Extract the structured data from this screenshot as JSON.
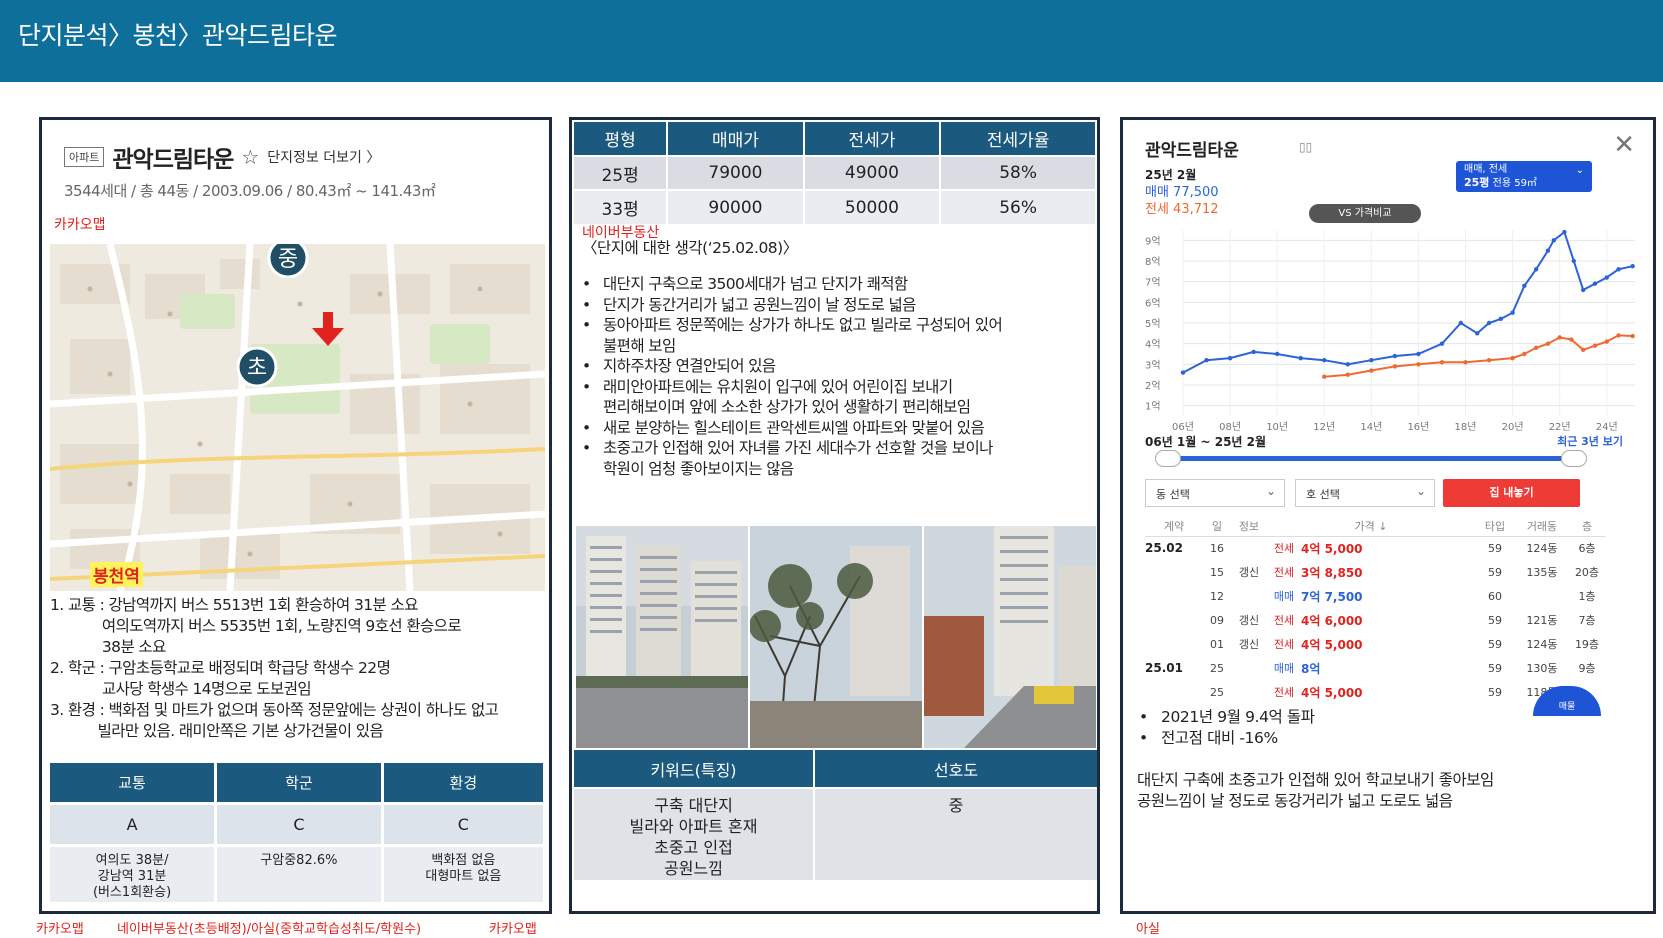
{
  "header": {
    "title": "단지분석〉봉천〉관악드림타운"
  },
  "panel1": {
    "badge": "아파트",
    "name": "관악드림타운",
    "more_link": "단지정보 더보기 〉",
    "meta": "3544세대 / 총 44동 / 2003.09.06 / 80.43㎡ ~ 141.43㎡",
    "source_top": "카카오맵",
    "map": {
      "marker_middle": "중",
      "marker_elem": "초",
      "station": "봉천역"
    },
    "notes": [
      "1.   교통 : 강남역까지 버스 5513번 1회 환승하여 31분 소요",
      "            여의도역까지 버스 5535번 1회, 노량진역 9호선 환승으로",
      "            38분 소요",
      "2. 학군 : 구암초등학교로 배정되며 학급당 학생수 22명",
      "            교사당 학생수 14명으로 도보권임",
      "3. 환경 : 백화점 및 마트가 없으며 동아쪽 정문앞에는 상권이 하나도 없고",
      "           빌라만 있음. 래미안쪽은 기본 상가건물이 있음"
    ],
    "grade_table": {
      "headers": [
        "교통",
        "학군",
        "환경"
      ],
      "grades": [
        "A",
        "C",
        "C"
      ],
      "details": [
        [
          "여의도 38분/",
          "강남역 31분",
          "(버스1회환승)"
        ],
        [
          "구암중82.6%"
        ],
        [
          "백화점 없음",
          "대형마트 없음"
        ]
      ]
    },
    "source_bottom_left": "카카오맵",
    "source_bottom_mid": "네이버부동산(초등배정)/아실(중학교학습성취도/학원수)",
    "source_bottom_right": "카카오맵"
  },
  "panel2": {
    "price_table": {
      "headers": [
        "평형",
        "매매가",
        "전세가",
        "전세가율"
      ],
      "rows": [
        [
          "25평",
          "79000",
          "49000",
          "58%"
        ],
        [
          "33평",
          "90000",
          "50000",
          "56%"
        ]
      ]
    },
    "source": "네이버부동산",
    "thought_title": "〈단지에 대한 생각(‘25.02.08)〉",
    "bullets": [
      "대단지 구축으로 3500세대가 넘고 단지가 쾌적함",
      "단지가 동간거리가 넓고 공원느낌이 날 정도로 넓음",
      "동아아파트 정문쪽에는 상가가 하나도 없고 빌라로 구성되어 있어",
      "불편해 보임",
      "지하주차장 연결안되어 있음",
      "래미안아파트에는 유치원이 입구에 있어 어린이집 보내기",
      "편리해보이며 앞에 소소한 상가가 있어 생활하기 편리해보임",
      "새로 분양하는 힐스테이트 관악센트씨엘 아파트와 맞붙어 있음",
      "초중고가 인접해 있어 자녀를 가진 세대수가 선호할 것을 보이나",
      "학원이 엄청 좋아보이지는 않음"
    ],
    "bullet_flags": [
      true,
      true,
      true,
      false,
      true,
      true,
      false,
      true,
      true,
      false
    ],
    "keyword_table": {
      "headers": [
        "키워드(특징)",
        "선호도"
      ],
      "keywords": [
        "구축 대단지",
        "빌라와 아파트 혼재",
        "초중고 인접",
        "공원느낌"
      ],
      "preference": "중"
    }
  },
  "panel3": {
    "title": "관악드림타운",
    "month": "25년 2월",
    "sale_label": "매매 77,500",
    "jeonse_label": "전세 43,712",
    "type_select_top": "매매, 전세",
    "type_select_bottom": "25평",
    "type_select_area": "전용 59㎡",
    "vs_button": "VS 가격비교",
    "period": "06년 1월 ~ 25년 2월",
    "recent_button": "최근 3년 보기",
    "dong_select": "동 선택",
    "ho_select": "호 선택",
    "zip_button": "집 내놓기",
    "tx_headers": [
      "계약",
      "일",
      "정보",
      "가격 ↓",
      "타입",
      "거래동",
      "층"
    ],
    "tx_rows": [
      [
        "25.02",
        "16",
        "",
        "전세",
        "4억 5,000",
        "59",
        "124동",
        "6층"
      ],
      [
        "",
        "15",
        "갱신",
        "전세",
        "3억 8,850",
        "59",
        "135동",
        "20층"
      ],
      [
        "",
        "12",
        "",
        "매매",
        "7억 7,500",
        "60",
        "",
        "1층"
      ],
      [
        "",
        "09",
        "갱신",
        "전세",
        "4억 6,000",
        "59",
        "121동",
        "7층"
      ],
      [
        "",
        "01",
        "갱신",
        "전세",
        "4억 5,000",
        "59",
        "124동",
        "19층"
      ],
      [
        "25.01",
        "25",
        "",
        "매매",
        "8억",
        "59",
        "130동",
        "9층"
      ],
      [
        "",
        "25",
        "",
        "전세",
        "4억 5,000",
        "59",
        "118동",
        ""
      ]
    ],
    "fab": "매물",
    "bullets": [
      "2021년 9월 9.4억 돌파",
      "전고점 대비 -16%"
    ],
    "summary": [
      "대단지 구축에 초중고가 인접해 있어 학교보내기 좋아보임",
      "공원느낌이 날 정도로 동강거리가 넓고 도로도 넓음"
    ],
    "source": "아실"
  },
  "colors": {
    "header": "#0e6f9a",
    "table_head": "#1b5a7e",
    "sale": "#2d63d8",
    "jeonse": "#ef6a32",
    "source": "#e0231f"
  },
  "chart_data": {
    "type": "line",
    "x_ticks": [
      "06년",
      "08년",
      "10년",
      "12년",
      "14년",
      "16년",
      "18년",
      "20년",
      "22년",
      "24년"
    ],
    "y_ticks": [
      "9억",
      "8억",
      "7억",
      "6억",
      "5억",
      "4억",
      "3억",
      "2억",
      "1억"
    ],
    "ylim": [
      0.5,
      9.5
    ],
    "xlim": [
      2006.0,
      2025.2
    ],
    "grid": true,
    "series": [
      {
        "name": "매매",
        "color": "#2d63d8",
        "x": [
          2006.0,
          2007.0,
          2008.0,
          2009.0,
          2010.0,
          2011.0,
          2012.0,
          2013.0,
          2014.0,
          2015.0,
          2016.0,
          2017.0,
          2017.8,
          2018.5,
          2019.0,
          2019.5,
          2020.0,
          2020.5,
          2021.0,
          2021.5,
          2021.75,
          2022.2,
          2022.6,
          2023.0,
          2023.5,
          2024.0,
          2024.5,
          2025.1
        ],
        "y": [
          2.6,
          3.2,
          3.3,
          3.6,
          3.5,
          3.3,
          3.2,
          3.0,
          3.2,
          3.4,
          3.5,
          4.0,
          5.0,
          4.5,
          5.0,
          5.2,
          5.5,
          6.8,
          7.6,
          8.5,
          9.0,
          9.4,
          8.0,
          6.6,
          6.9,
          7.2,
          7.6,
          7.75
        ]
      },
      {
        "name": "전세",
        "color": "#ef6a32",
        "x": [
          2012.0,
          2013.0,
          2014.0,
          2015.0,
          2016.0,
          2017.0,
          2018.0,
          2019.0,
          2020.0,
          2020.5,
          2021.0,
          2021.5,
          2022.0,
          2022.5,
          2023.0,
          2023.5,
          2024.0,
          2024.5,
          2025.1
        ],
        "y": [
          2.4,
          2.5,
          2.7,
          2.9,
          3.0,
          3.1,
          3.1,
          3.2,
          3.3,
          3.5,
          3.8,
          4.0,
          4.3,
          4.2,
          3.7,
          3.9,
          4.1,
          4.4,
          4.37
        ]
      }
    ]
  }
}
